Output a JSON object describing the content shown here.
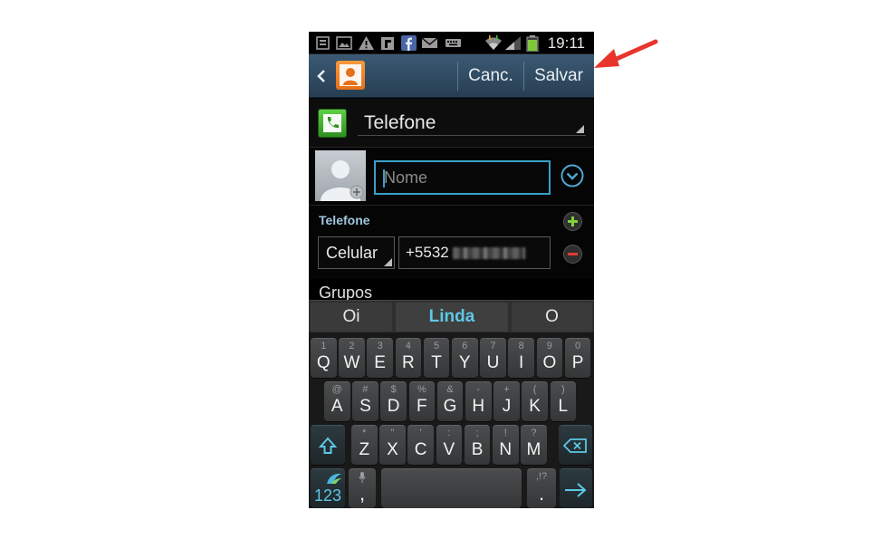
{
  "status_bar": {
    "time": "19:11",
    "icons": [
      "gallery-icon",
      "image-icon",
      "warning-icon",
      "flipboard-icon",
      "facebook-icon",
      "mail-icon",
      "keyboard-icon",
      "wifi-icon",
      "signal-icon",
      "battery-icon"
    ]
  },
  "action_bar": {
    "cancel_label": "Canc.",
    "save_label": "Salvar",
    "accent_color": "#e5701a"
  },
  "account": {
    "label": "Telefone",
    "icon_color": "#3fae2c"
  },
  "name": {
    "placeholder": "Nome",
    "value": ""
  },
  "phone": {
    "section_title": "Telefone",
    "type": "Celular",
    "number_visible": "+5532"
  },
  "groups": {
    "title": "Grupos"
  },
  "suggestions": {
    "left": "Oi",
    "center": "Linda",
    "right": "O",
    "highlight_color": "#5ec8e6"
  },
  "keyboard": {
    "row1": [
      {
        "main": "Q",
        "sub": "1"
      },
      {
        "main": "W",
        "sub": "2"
      },
      {
        "main": "E",
        "sub": "3"
      },
      {
        "main": "R",
        "sub": "4"
      },
      {
        "main": "T",
        "sub": "5"
      },
      {
        "main": "Y",
        "sub": "6"
      },
      {
        "main": "U",
        "sub": "7"
      },
      {
        "main": "I",
        "sub": "8"
      },
      {
        "main": "O",
        "sub": "9"
      },
      {
        "main": "P",
        "sub": "0"
      }
    ],
    "row2": [
      {
        "main": "A",
        "sub": "@"
      },
      {
        "main": "S",
        "sub": "#"
      },
      {
        "main": "D",
        "sub": "$"
      },
      {
        "main": "F",
        "sub": "%"
      },
      {
        "main": "G",
        "sub": "&"
      },
      {
        "main": "H",
        "sub": "-"
      },
      {
        "main": "J",
        "sub": "+"
      },
      {
        "main": "K",
        "sub": "("
      },
      {
        "main": "L",
        "sub": ")"
      }
    ],
    "row3": [
      {
        "main": "Z",
        "sub": "*"
      },
      {
        "main": "X",
        "sub": "\""
      },
      {
        "main": "C",
        "sub": "'"
      },
      {
        "main": "V",
        "sub": ":"
      },
      {
        "main": "B",
        "sub": ";"
      },
      {
        "main": "N",
        "sub": "!"
      },
      {
        "main": "M",
        "sub": "?"
      }
    ],
    "symbols_label": "123",
    "comma_label": ",",
    "period_label": ".",
    "period_sub": ",!?",
    "accent_color": "#5ec8e6"
  },
  "annotation": {
    "arrow_color": "#e8352b"
  }
}
